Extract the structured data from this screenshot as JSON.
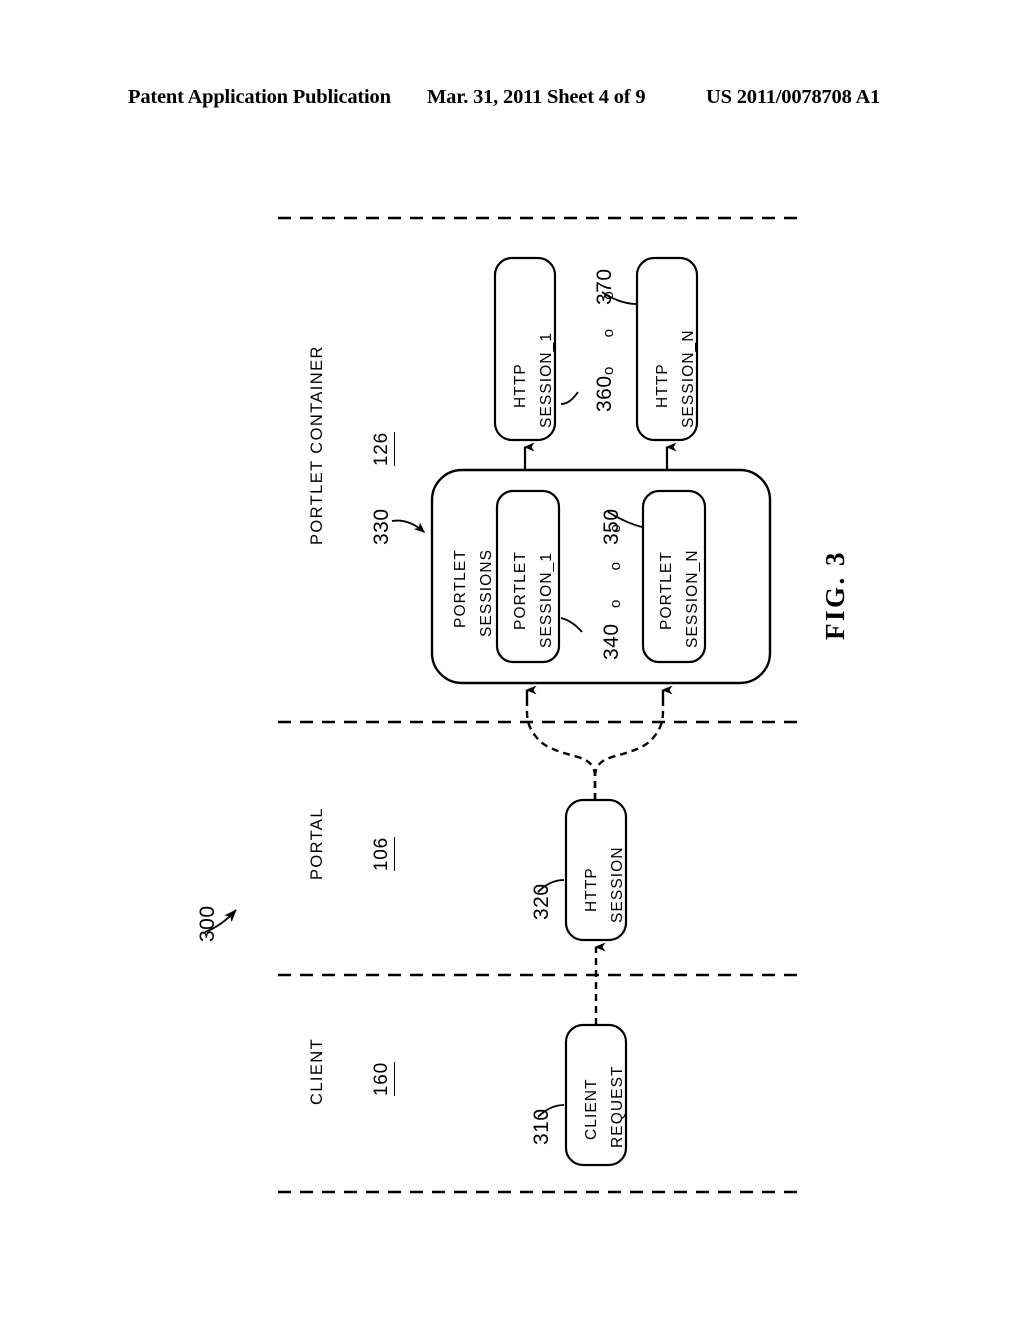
{
  "header": {
    "left": "Patent Application Publication",
    "middle": "Mar. 31, 2011  Sheet 4 of 9",
    "right": "US 2011/0078708 A1"
  },
  "figure": {
    "label": "FIG. 3",
    "diagram_ref": "300"
  },
  "lanes": [
    {
      "name": "portlet-container",
      "label": "PORTLET CONTAINER",
      "number": "126"
    },
    {
      "name": "portal",
      "label": "PORTAL",
      "number": "106"
    },
    {
      "name": "client",
      "label": "CLIENT",
      "number": "160"
    }
  ],
  "nodes": {
    "http_session_1": {
      "line1": "HTTP",
      "line2": "SESSION_1",
      "ref": "360"
    },
    "http_session_n": {
      "line1": "HTTP",
      "line2": "SESSION_N",
      "ref": "370"
    },
    "portlet_sessions": {
      "line1": "PORTLET",
      "line2": "SESSIONS",
      "ref": "330"
    },
    "portlet_session_1": {
      "line1": "PORTLET",
      "line2": "SESSION_1",
      "ref": "340"
    },
    "portlet_session_n": {
      "line1": "PORTLET",
      "line2": "SESSION_N",
      "ref": "350"
    },
    "http_session": {
      "line1": "HTTP",
      "line2": "SESSION",
      "ref": "320"
    },
    "client_request": {
      "line1": "CLIENT",
      "line2": "REQUEST",
      "ref": "310"
    }
  },
  "ellipsis": "o  o  o",
  "colors": {
    "ink": "#000000",
    "paper": "#ffffff"
  }
}
